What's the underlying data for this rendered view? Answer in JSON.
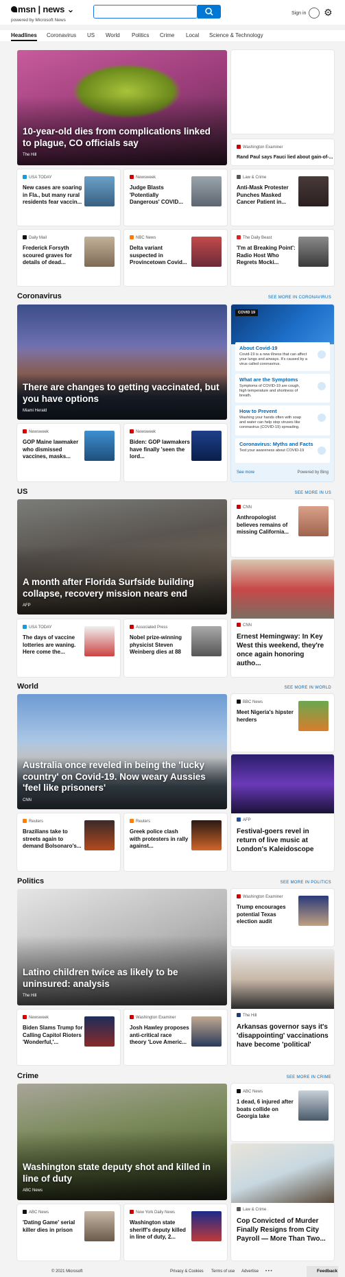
{
  "header": {
    "brand": "msn",
    "section": "news",
    "powered": "powered by Microsoft News",
    "search_placeholder": "",
    "signin": "Sign in"
  },
  "nav": [
    "Headlines",
    "Coronavirus",
    "US",
    "World",
    "Politics",
    "Crime",
    "Local",
    "Science & Technology"
  ],
  "headlines": {
    "hero": {
      "title": "10-year-old dies from complications linked to plague, CO officials say",
      "source": "The Hill"
    },
    "side_top": {
      "source": "Washington Examiner",
      "title": "Rand Paul says Fauci lied about gain-of-..."
    },
    "row1": [
      {
        "source": "USA TODAY",
        "title": "New cases are soaring in Fla., but many rural residents fear vaccin..."
      },
      {
        "source": "Newsweek",
        "title": "Judge Blasts 'Potentially Dangerous' COVID..."
      },
      {
        "source": "Law & Crime",
        "title": "Anti-Mask Protester Punches Masked Cancer Patient in..."
      }
    ],
    "row2": [
      {
        "source": "Daily Mail",
        "title": "Frederick Forsyth scoured graves for details of dead..."
      },
      {
        "source": "NBC News",
        "title": "Delta variant suspected in Provincetown Covid..."
      },
      {
        "source": "The Daily Beast",
        "title": "'I'm at Breaking Point': Radio Host Who Regrets Mocki..."
      }
    ]
  },
  "coronavirus": {
    "heading": "Coronavirus",
    "see_more": "SEE MORE IN CORONAVIRUS",
    "hero": {
      "title": "There are changes to getting vaccinated, but you have options",
      "source": "Miami Herald"
    },
    "row": [
      {
        "source": "Newsweek",
        "title": "GOP Maine lawmaker who dismissed vaccines, masks..."
      },
      {
        "source": "Newsweek",
        "title": "Biden: GOP lawmakers have finally 'seen the lord..."
      }
    ],
    "panel": {
      "tag": "COVID 19",
      "items": [
        {
          "title": "About Covid-19",
          "desc": "Covid-19 is a new illness that can affect your lungs and airways. It's caused by a virus called coronavirus."
        },
        {
          "title": "What are the Symptoms",
          "desc": "Symptoms of COVID-19 are cough, high temperature and shortness of breath."
        },
        {
          "title": "How to Prevent",
          "desc": "Washing your hands often with soap and water can help stop viruses like coronavirus (COVID-19) spreading."
        },
        {
          "title": "Coronavirus: Myths and Facts",
          "desc": "Test your awareness about COVID-19"
        }
      ],
      "see_more": "See more",
      "powered": "Powered by Bing"
    }
  },
  "us": {
    "heading": "US",
    "see_more": "SEE MORE IN US",
    "hero": {
      "title": "A month after Florida Surfside building collapse, recovery mission nears end",
      "source": "AFP"
    },
    "side1": {
      "source": "CNN",
      "title": "Anthropologist believes remains of missing California..."
    },
    "side2": {
      "source": "CNN",
      "title": "Ernest Hemingway: In Key West this weekend, they're once again honoring autho..."
    },
    "row": [
      {
        "source": "USA TODAY",
        "title": "The days of vaccine lotteries are waning. Here come the..."
      },
      {
        "source": "Associated Press",
        "title": "Nobel prize-winning physicist Steven Weinberg dies at 88"
      }
    ]
  },
  "world": {
    "heading": "World",
    "see_more": "SEE MORE IN WORLD",
    "hero": {
      "title": "Australia once reveled in being the 'lucky country' on Covid-19. Now weary Aussies 'feel like prisoners'",
      "source": "CNN"
    },
    "side1": {
      "source": "BBC News",
      "title": "Meet Nigeria's hipster herders"
    },
    "side2": {
      "source": "AFP",
      "title": "Festival-goers revel in return of live music at London's Kaleidoscope"
    },
    "row": [
      {
        "source": "Reuters",
        "title": "Brazilians take to streets again to demand Bolsonaro's..."
      },
      {
        "source": "Reuters",
        "title": "Greek police clash with protesters in rally against..."
      }
    ]
  },
  "politics": {
    "heading": "Politics",
    "see_more": "SEE MORE IN POLITICS",
    "hero": {
      "title": "Latino children twice as likely to be uninsured: analysis",
      "source": "The Hill"
    },
    "side1": {
      "source": "Washington Examiner",
      "title": "Trump encourages potential Texas election audit"
    },
    "side2": {
      "source": "The Hill",
      "title": "Arkansas governor says it's 'disappointing' vaccinations have become 'political'"
    },
    "row": [
      {
        "source": "Newsweek",
        "title": "Biden Slams Trump for Calling Capitol Rioters 'Wonderful,'..."
      },
      {
        "source": "Washington Examiner",
        "title": "Josh Hawley proposes anti-critical race theory 'Love Americ..."
      }
    ]
  },
  "crime": {
    "heading": "Crime",
    "see_more": "SEE MORE IN CRIME",
    "hero": {
      "title": "Washington state deputy shot and killed in line of duty",
      "source": "ABC News"
    },
    "side1": {
      "source": "ABC News",
      "title": "1 dead, 6 injured after boats collide on Georgia lake"
    },
    "side2": {
      "source": "Law & Crime",
      "title": "Cop Convicted of Murder Finally Resigns from City Payroll — More Than Two..."
    },
    "row": [
      {
        "source": "ABC News",
        "title": "'Dating Game' serial killer dies in prison"
      },
      {
        "source": "New York Daily News",
        "title": "Washington state sheriff's deputy killed in line of duty, 2..."
      }
    ]
  },
  "footer": {
    "copyright": "© 2021 Microsoft",
    "privacy": "Privacy & Cookies",
    "terms": "Terms of use",
    "advertise": "Advertise",
    "more": "• • •",
    "feedback": "Feedback"
  }
}
